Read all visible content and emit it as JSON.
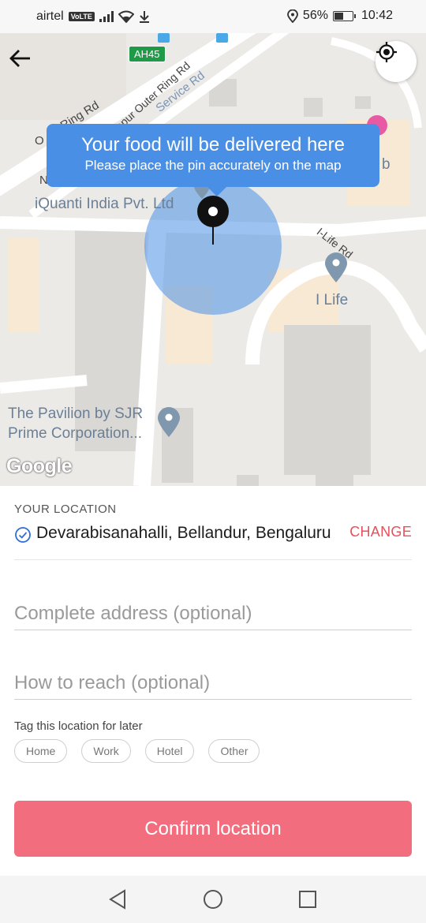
{
  "status_bar": {
    "carrier": "airtel",
    "network_badge": "VoLTE",
    "battery_percent": "56%",
    "battery_level": 0.56,
    "time": "10:42",
    "icons": [
      "signal-icon",
      "wifi-icon",
      "download-icon",
      "location-icon",
      "battery-icon"
    ]
  },
  "map": {
    "highway_badge": "AH45",
    "labels": {
      "ring_rd": "Ring Rd",
      "outer_ring_rd": "riapur Outer Ring Rd",
      "service_rd": "Service Rd",
      "iquanti": "iQuanti India Pvt. Ltd",
      "ilife_rd": "I-Life Rd",
      "ilife": "I Life",
      "pavilion_line1": "The Pavilion by SJR",
      "pavilion_line2": "Prime Corporation...",
      "edge_o": "O",
      "edge_n": "N",
      "edge_b": "b"
    },
    "tooltip": {
      "title": "Your food will be delivered here",
      "subtitle": "Please place the pin accurately on the map"
    },
    "google_logo": "Google",
    "colors": {
      "pin_radius": "#4a8fe6",
      "tooltip": "#4a8fe6"
    }
  },
  "sheet": {
    "your_location_label": "YOUR LOCATION",
    "location_text": "Devarabisanahalli, Bellandur, Bengaluru",
    "change_label": "CHANGE",
    "complete_address_placeholder": "Complete address (optional)",
    "how_to_reach_placeholder": "How to reach (optional)",
    "tag_title": "Tag this location for later",
    "tags": [
      "Home",
      "Work",
      "Hotel",
      "Other"
    ],
    "confirm_label": "Confirm location",
    "colors": {
      "accent": "#e8505b",
      "confirm_bg": "#f26e7e"
    }
  },
  "nav_bar": {
    "buttons": [
      "back-icon",
      "home-icon",
      "recents-icon"
    ]
  }
}
